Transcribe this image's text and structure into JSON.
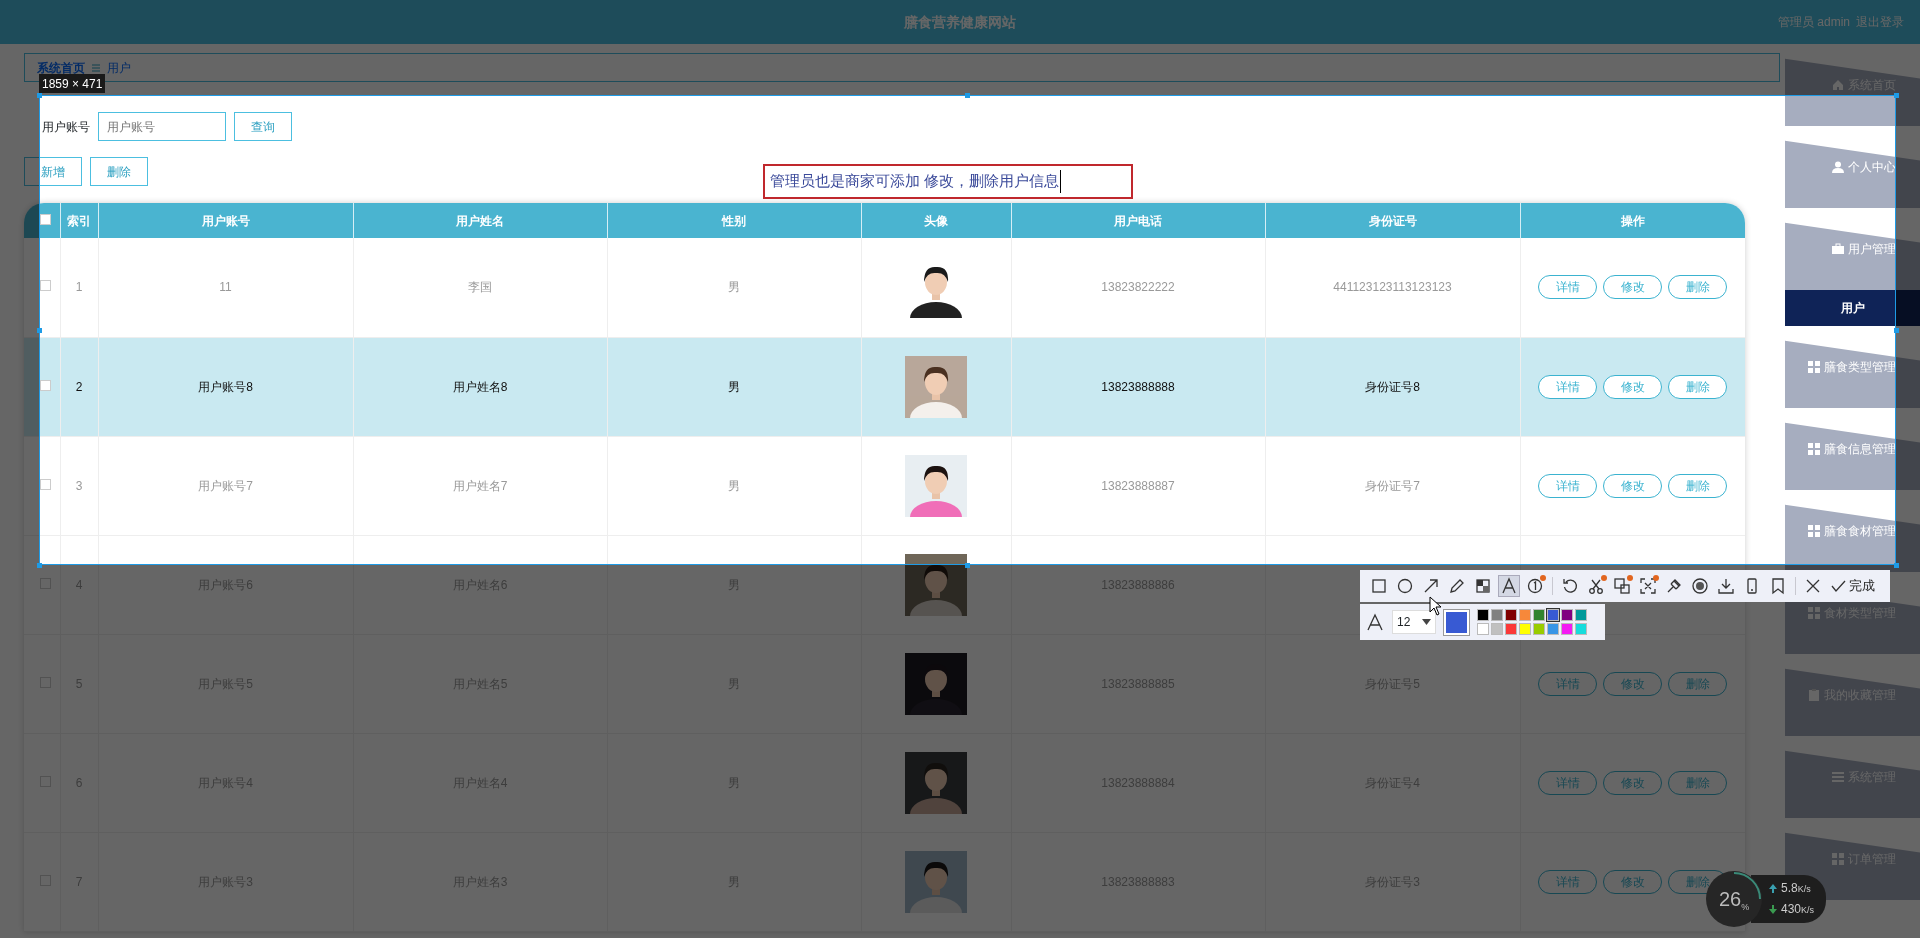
{
  "header": {
    "title": "膳食营养健康网站",
    "user": "管理员 admin",
    "logout": "退出登录"
  },
  "breadcrumb": [
    "系统首页",
    "用户"
  ],
  "search": {
    "label": "用户账号",
    "placeholder": "用户账号",
    "button": "查询"
  },
  "actions": [
    "新增",
    "删除"
  ],
  "table": {
    "header_checked": false,
    "columns": [
      "索引",
      "用户账号",
      "用户姓名",
      "性别",
      "头像",
      "用户电话",
      "身份证号",
      "操作"
    ],
    "rows": [
      {
        "checked": false,
        "selected": false,
        "index": "1",
        "account": "11",
        "name": "李国",
        "gender": "男",
        "phone": "13823822222",
        "id_number": "441123123113123123",
        "buttons": [
          "详情",
          "修改",
          "删除"
        ]
      },
      {
        "checked": false,
        "selected": true,
        "index": "2",
        "account": "用户账号8",
        "name": "用户姓名8",
        "gender": "男",
        "phone": "13823888888",
        "id_number": "身份证号8",
        "buttons": [
          "详情",
          "修改",
          "删除"
        ]
      },
      {
        "checked": false,
        "selected": false,
        "index": "3",
        "account": "用户账号7",
        "name": "用户姓名7",
        "gender": "男",
        "phone": "13823888887",
        "id_number": "身份证号7",
        "buttons": [
          "详情",
          "修改",
          "删除"
        ]
      },
      {
        "checked": false,
        "selected": false,
        "index": "4",
        "account": "用户账号6",
        "name": "用户姓名6",
        "gender": "男",
        "phone": "13823888886"
      },
      {
        "checked": false,
        "selected": false,
        "index": "5",
        "account": "用户账号5",
        "name": "用户姓名5",
        "gender": "男",
        "phone": "13823888885",
        "id_number": "身份证号5",
        "buttons": [
          "详情",
          "修改",
          "删除"
        ]
      },
      {
        "checked": false,
        "selected": false,
        "index": "6",
        "account": "用户账号4",
        "name": "用户姓名4",
        "gender": "男",
        "phone": "13823888884",
        "id_number": "身份证号4",
        "buttons": [
          "详情",
          "修改",
          "删除"
        ]
      },
      {
        "checked": false,
        "selected": false,
        "index": "7",
        "account": "用户账号3",
        "name": "用户姓名3",
        "gender": "男",
        "phone": "13823888883",
        "id_number": "身份证号3",
        "buttons": [
          "详情",
          "修改",
          "删除"
        ]
      }
    ]
  },
  "sidebar": {
    "items": [
      {
        "label": "系统首页",
        "kind": "home",
        "selected": false
      },
      {
        "label": "个人中心",
        "kind": "user",
        "selected": false
      },
      {
        "label": "用户管理",
        "kind": "briefcase",
        "selected": false
      },
      {
        "label": "用户",
        "kind": "sub",
        "selected": true
      },
      {
        "label": "膳食类型管理",
        "kind": "grid",
        "selected": false
      },
      {
        "label": "膳食信息管理",
        "kind": "grid",
        "selected": false
      },
      {
        "label": "膳食食材管理",
        "kind": "grid",
        "selected": false
      },
      {
        "label": "食材类型管理",
        "kind": "grid",
        "selected": false
      },
      {
        "label": "我的收藏管理",
        "kind": "clipboard",
        "selected": false
      },
      {
        "label": "系统管理",
        "kind": "list",
        "selected": false
      },
      {
        "label": "订单管理",
        "kind": "grid",
        "selected": false
      }
    ]
  },
  "selection": {
    "size": "1859 × 471"
  },
  "annotation": {
    "text": "管理员也是商家可添加 修改，删除用户信息"
  },
  "toolbar": {
    "tool_groups": [
      [
        {
          "kind": "rectangle",
          "selected": false,
          "dot": false
        },
        {
          "kind": "circle",
          "selected": false,
          "dot": false
        },
        {
          "kind": "arrow",
          "selected": false,
          "dot": false
        },
        {
          "kind": "pencil",
          "selected": false,
          "dot": false
        },
        {
          "kind": "mosaic",
          "selected": false,
          "dot": false
        },
        {
          "kind": "text",
          "selected": true,
          "dot": false
        },
        {
          "kind": "number",
          "selected": false,
          "dot": true
        }
      ],
      [
        {
          "kind": "undo",
          "selected": false,
          "dot": false
        },
        {
          "kind": "scissors",
          "selected": false,
          "dot": true
        },
        {
          "kind": "translate",
          "selected": false,
          "dot": true
        },
        {
          "kind": "scan",
          "selected": false,
          "dot": true
        },
        {
          "kind": "pin",
          "selected": false,
          "dot": false
        },
        {
          "kind": "record",
          "selected": false,
          "dot": false
        },
        {
          "kind": "download",
          "selected": false,
          "dot": false
        },
        {
          "kind": "phone",
          "selected": false,
          "dot": false
        },
        {
          "kind": "bookmark",
          "selected": false,
          "dot": false
        }
      ],
      [
        {
          "kind": "close",
          "selected": false,
          "dot": false
        }
      ]
    ],
    "done": "完成",
    "font_size": "12",
    "palette": [
      {
        "color": "#000000",
        "selected": false
      },
      {
        "color": "#808080",
        "selected": false
      },
      {
        "color": "#800000",
        "selected": false
      },
      {
        "color": "#f7883a",
        "selected": false
      },
      {
        "color": "#308430",
        "selected": false
      },
      {
        "color": "#385ad3",
        "selected": true
      },
      {
        "color": "#800080",
        "selected": false
      },
      {
        "color": "#009999",
        "selected": false
      },
      {
        "color": "#ffffff",
        "selected": false
      },
      {
        "color": "#c0c0c0",
        "selected": false
      },
      {
        "color": "#fb3838",
        "selected": false
      },
      {
        "color": "#ffff00",
        "selected": false
      },
      {
        "color": "#99cc00",
        "selected": false
      },
      {
        "color": "#3895e6",
        "selected": false
      },
      {
        "color": "#f31bf3",
        "selected": false
      },
      {
        "color": "#16dcdc",
        "selected": false
      }
    ]
  },
  "net_widget": {
    "load": "26",
    "load_unit": "%",
    "up": "5.8",
    "up_unit": "K/s",
    "down": "430",
    "down_unit": "K/s"
  }
}
